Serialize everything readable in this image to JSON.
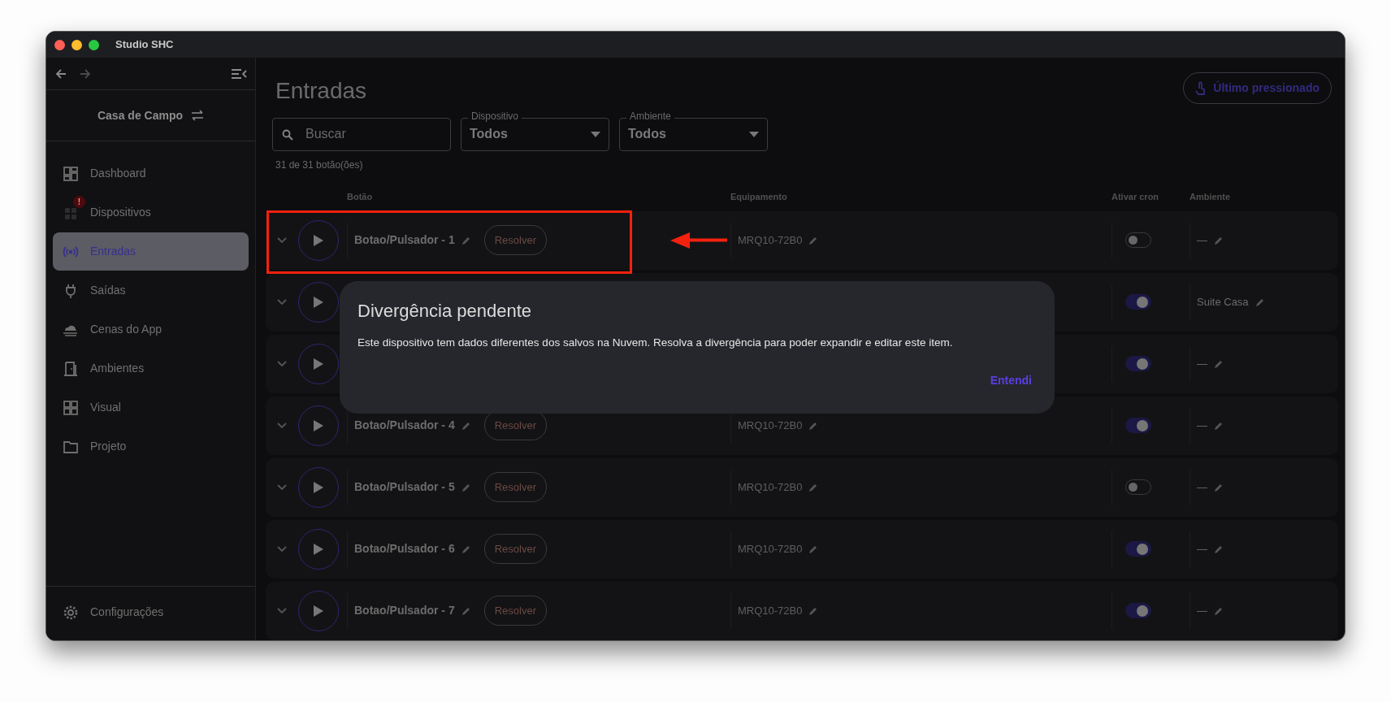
{
  "window": {
    "title": "Studio SHC"
  },
  "sidebar": {
    "workspace": "Casa de Campo",
    "items": [
      {
        "label": "Dashboard",
        "selected": false
      },
      {
        "label": "Dispositivos",
        "selected": false,
        "alert": "!"
      },
      {
        "label": "Entradas",
        "selected": true
      },
      {
        "label": "Saídas",
        "selected": false
      },
      {
        "label": "Cenas do App",
        "selected": false
      },
      {
        "label": "Ambientes",
        "selected": false
      },
      {
        "label": "Visual",
        "selected": false
      },
      {
        "label": "Projeto",
        "selected": false
      }
    ],
    "footer_item": {
      "label": "Configurações"
    }
  },
  "page": {
    "title": "Entradas",
    "last_pressed_button": "Último pressionado",
    "search": {
      "placeholder": "Buscar"
    },
    "filters": [
      {
        "label": "Dispositivo",
        "value": "Todos"
      },
      {
        "label": "Ambiente",
        "value": "Todos"
      }
    ],
    "count": "31 de 31 botão(ões)"
  },
  "table": {
    "columns": [
      "Botão",
      "Equipamento",
      "Ativar cron",
      "Ambiente"
    ],
    "rows": [
      {
        "name": "Botao/Pulsador - 1",
        "action": "Resolver",
        "equipment": "MRQ10-72B0",
        "cron": false,
        "room": "—",
        "highlighted": true
      },
      {
        "cron": true,
        "room": "Suite Casa",
        "highlighted": false
      },
      {
        "cron": true,
        "room": "—",
        "highlighted": false
      },
      {
        "name": "Botao/Pulsador - 4",
        "action": "Resolver",
        "equipment": "MRQ10-72B0",
        "cron": true,
        "room": "—",
        "highlighted": false
      },
      {
        "name": "Botao/Pulsador - 5",
        "action": "Resolver",
        "equipment": "MRQ10-72B0",
        "cron": false,
        "room": "—",
        "highlighted": false
      },
      {
        "name": "Botao/Pulsador - 6",
        "action": "Resolver",
        "equipment": "MRQ10-72B0",
        "cron": true,
        "room": "—",
        "highlighted": false
      },
      {
        "name": "Botao/Pulsador - 7",
        "action": "Resolver",
        "equipment": "MRQ10-72B0",
        "cron": true,
        "room": "—",
        "highlighted": false
      }
    ]
  },
  "dialog": {
    "title": "Divergência pendente",
    "message": "Este dispositivo tem dados diferentes dos salvos na Nuvem. Resolva a divergência para poder expandir e editar este item.",
    "action": "Entendi"
  }
}
